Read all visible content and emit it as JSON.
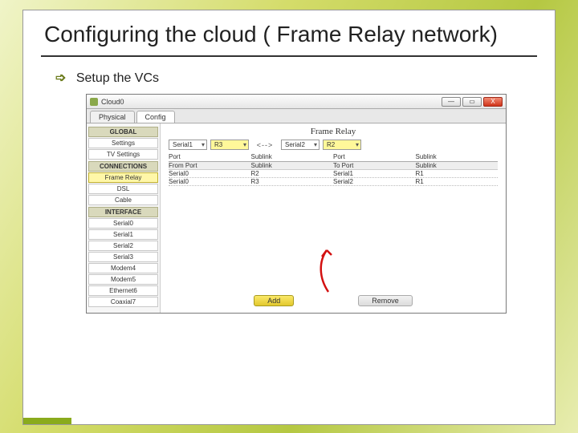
{
  "slide": {
    "title": "Configuring the cloud ( Frame Relay network)",
    "bullet": "Setup the VCs"
  },
  "window": {
    "title": "Cloud0",
    "controls": {
      "min": "—",
      "max": "▭",
      "close": "X"
    },
    "tabs": {
      "physical": "Physical",
      "config": "Config"
    }
  },
  "sidebar": {
    "global_header": "GLOBAL",
    "global": [
      "Settings",
      "TV Settings"
    ],
    "connections_header": "CONNECTIONS",
    "connections": [
      "Frame Relay",
      "DSL",
      "Cable"
    ],
    "interface_header": "INTERFACE",
    "interfaces": [
      "Serial0",
      "Serial1",
      "Serial2",
      "Serial3",
      "Modem4",
      "Modem5",
      "Ethernet6",
      "Coaxial7"
    ]
  },
  "panel": {
    "title": "Frame Relay",
    "left_port": "Serial1",
    "left_sublink": "R3",
    "right_port": "Serial2",
    "right_sublink": "R2",
    "arrow": "<-->",
    "headers": {
      "port_l": "Port",
      "sublink_l": "Sublink",
      "port_r": "Port",
      "sublink_r": "Sublink"
    },
    "subheaders": {
      "from_port": "From Port",
      "sublink_l": "Sublink",
      "to_port": "To Port",
      "sublink_r": "Sublink"
    },
    "rows": [
      {
        "from_port": "Serial0",
        "sublink_l": "R2",
        "to_port": "Serial1",
        "sublink_r": "R1"
      },
      {
        "from_port": "Serial0",
        "sublink_l": "R3",
        "to_port": "Serial2",
        "sublink_r": "R1"
      }
    ],
    "add_btn": "Add",
    "remove_btn": "Remove"
  }
}
